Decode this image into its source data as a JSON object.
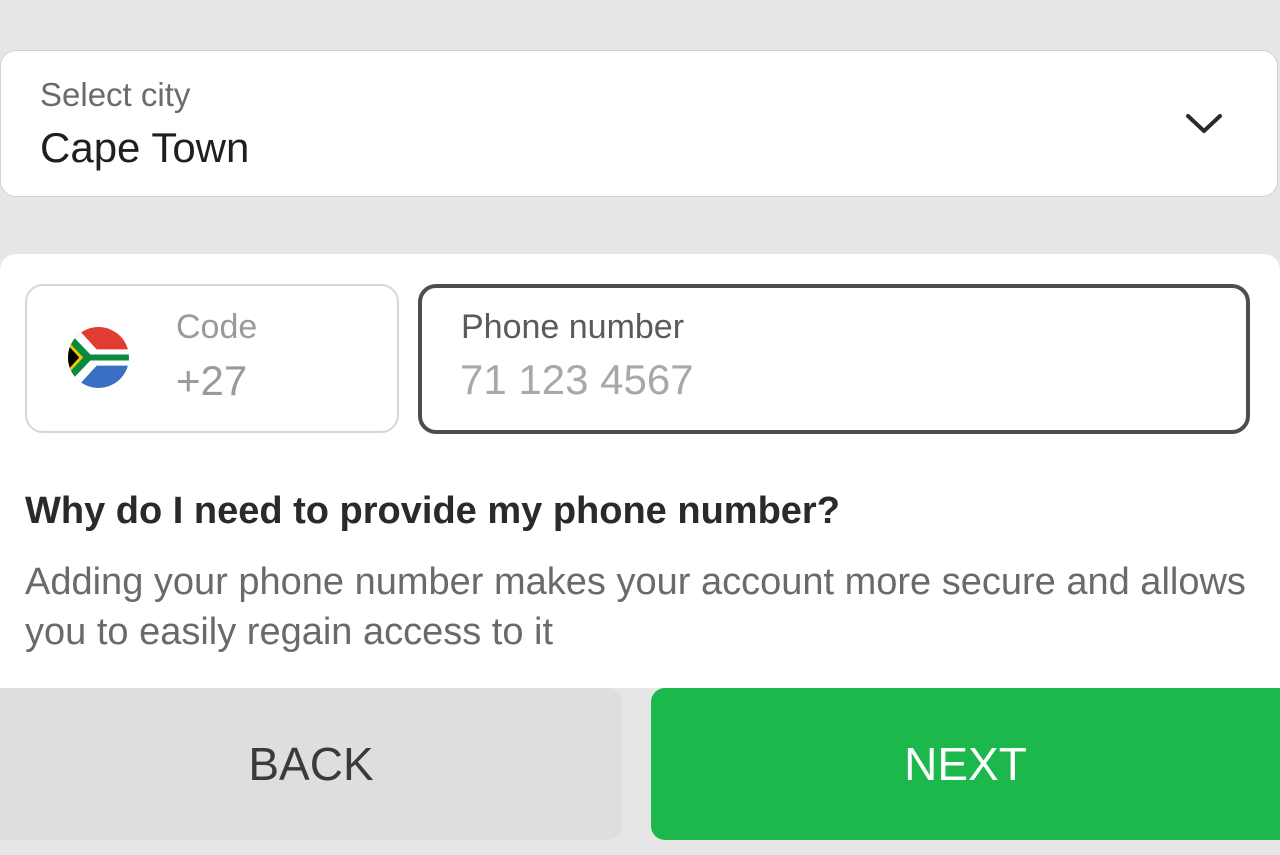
{
  "city_select": {
    "label": "Select city",
    "value": "Cape Town",
    "icon": "chevron-down-icon"
  },
  "phone": {
    "code_label": "Code",
    "code_value": "+27",
    "country_flag": "south-africa-flag-icon",
    "number_label": "Phone number",
    "number_placeholder": "71 123 4567",
    "number_value": ""
  },
  "info": {
    "title": "Why do I need to provide my phone number?",
    "text": "Adding your phone number makes your account more secure and allows you to easily regain access to it"
  },
  "buttons": {
    "back_label": "BACK",
    "next_label": "NEXT"
  },
  "colors": {
    "background": "#e6e6e6",
    "next_button": "#1db84b",
    "back_button": "#dedede",
    "focused_border": "#4d4d4d"
  }
}
